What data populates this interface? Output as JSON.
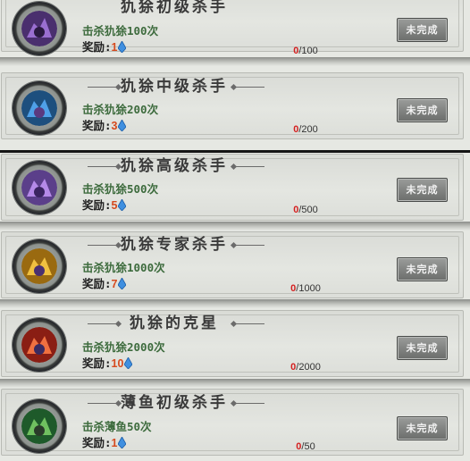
{
  "achievements": [
    {
      "title": "犰狳初级杀手",
      "desc": "击杀犰狳100次",
      "reward_label": "奖励:",
      "reward_value": "1",
      "progress_current": "0",
      "progress_total": "/100",
      "button": "未完成",
      "icon_color": "#6a3fa0"
    },
    {
      "title": "犰狳中级杀手",
      "desc": "击杀犰狳200次",
      "reward_label": "奖励:",
      "reward_value": "3",
      "progress_current": "0",
      "progress_total": "/200",
      "button": "未完成",
      "icon_color": "#2f7fc9"
    },
    {
      "title": "犰狳高级杀手",
      "desc": "击杀犰狳500次",
      "reward_label": "奖励:",
      "reward_value": "5",
      "progress_current": "0",
      "progress_total": "/500",
      "button": "未完成",
      "icon_color": "#8a5bd0"
    },
    {
      "title": "犰狳专家杀手",
      "desc": "击杀犰狳1000次",
      "reward_label": "奖励:",
      "reward_value": "7",
      "progress_current": "0",
      "progress_total": "/1000",
      "button": "未完成",
      "icon_color": "#e0a020"
    },
    {
      "title": "犰狳的克星",
      "desc": "击杀犰狳2000次",
      "reward_label": "奖励:",
      "reward_value": "10",
      "progress_current": "0",
      "progress_total": "/2000",
      "button": "未完成",
      "icon_color": "#d03020"
    },
    {
      "title": "薄鱼初级杀手",
      "desc": "击杀薄鱼50次",
      "reward_label": "奖励:",
      "reward_value": "1",
      "progress_current": "0",
      "progress_total": "/50",
      "button": "未完成",
      "icon_color": "#3a9a3a"
    }
  ]
}
